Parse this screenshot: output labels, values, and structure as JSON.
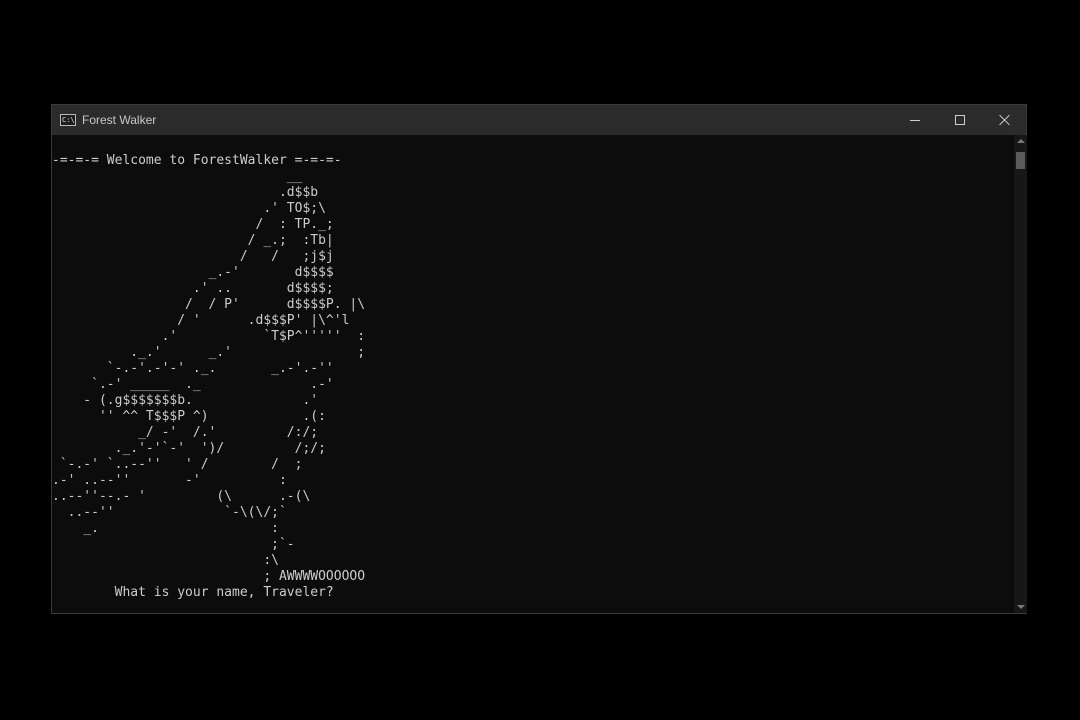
{
  "window": {
    "title": "Forest Walker",
    "icon": "console-app-icon",
    "icon_text": "C:\\"
  },
  "controls": {
    "minimize": "minimize-icon",
    "maximize": "maximize-icon",
    "close": "close-icon"
  },
  "console": {
    "lines": [
      "-=-=-= Welcome to ForestWalker =-=-=-",
      "                              __",
      "                             .d$$b",
      "                           .' TO$;\\",
      "                          /  : TP._;",
      "                         / _.;  :Tb|",
      "                        /   /   ;j$j",
      "                    _.-'       d$$$$",
      "                  .' ..       d$$$$;",
      "                 /  / P'      d$$$$P. |\\",
      "                / '      .d$$$P' |\\^'l",
      "              .'           `T$P^'''''  :",
      "          ._.'      _.'                ;",
      "       `-.-'.-'-' ._.       _.-'.-''",
      "     `.-' _____  ._              .-'",
      "    - (.g$$$$$$$b.              .'",
      "      '' ^^ T$$$P ^)            .(:",
      "           _/ -'  /.'         /:/;",
      "        ._.'-'`-'  ')/         /;/;",
      " `-.-' `..--''   ' /        /  ;",
      ".-' ..--''       -'          :",
      "..--''--.- '         (\\      .-(\\",
      "  ..--''              `-\\(\\/;`",
      "    _.                      :",
      "                            ;`-",
      "                           :\\",
      "                           ; AWWWWOOOOOO",
      "        What is your name, Traveler?"
    ]
  },
  "scrollbar": {
    "up": "scroll-up-arrow-icon",
    "down": "scroll-down-arrow-icon"
  }
}
